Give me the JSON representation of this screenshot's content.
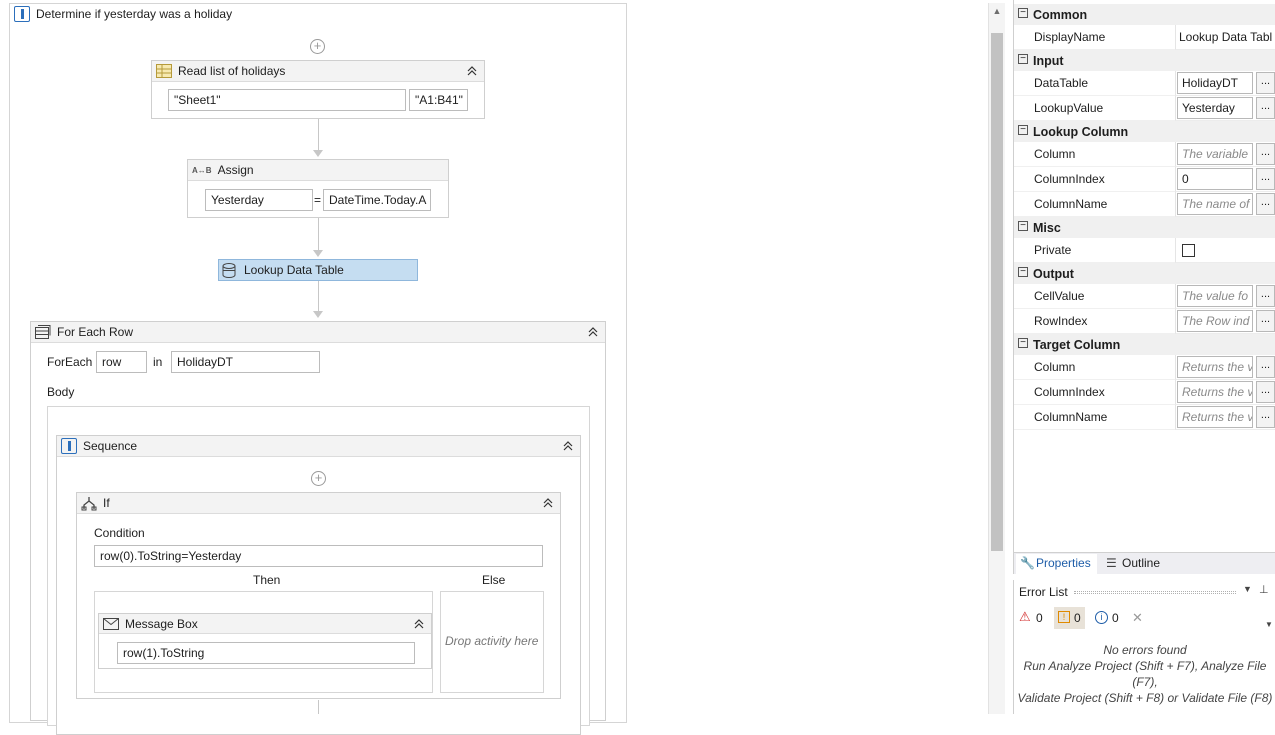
{
  "workflow": {
    "sequence_title": "Determine if yesterday was a holiday",
    "read_range": {
      "title": "Read list of holidays",
      "sheet": "\"Sheet1\"",
      "range": "\"A1:B41\""
    },
    "assign": {
      "title": "Assign",
      "to": "Yesterday",
      "eq": "=",
      "value": "DateTime.Today.A"
    },
    "lookup": {
      "title": "Lookup Data Table"
    },
    "foreach": {
      "title": "For Each Row",
      "foreach_label": "ForEach",
      "item": "row",
      "in_label": "in",
      "collection": "HolidayDT",
      "body_label": "Body",
      "sequence": {
        "title": "Sequence",
        "if": {
          "title": "If",
          "condition_label": "Condition",
          "condition": "row(0).ToString=Yesterday",
          "then_label": "Then",
          "else_label": "Else",
          "else_placeholder": "Drop activity here",
          "message_box": {
            "title": "Message Box",
            "text": "row(1).ToString"
          }
        }
      }
    }
  },
  "properties": {
    "categories": [
      {
        "name": "Common",
        "rows": [
          {
            "name": "DisplayName",
            "value": "Lookup Data Tabl",
            "plain": true
          }
        ]
      },
      {
        "name": "Input",
        "rows": [
          {
            "name": "DataTable",
            "value": "HolidayDT"
          },
          {
            "name": "LookupValue",
            "value": "Yesterday"
          }
        ]
      },
      {
        "name": "Lookup Column",
        "rows": [
          {
            "name": "Column",
            "placeholder": "The variable"
          },
          {
            "name": "ColumnIndex",
            "value": "0"
          },
          {
            "name": "ColumnName",
            "placeholder": "The name of"
          }
        ]
      },
      {
        "name": "Misc",
        "rows": [
          {
            "name": "Private",
            "checkbox": true
          }
        ]
      },
      {
        "name": "Output",
        "rows": [
          {
            "name": "CellValue",
            "placeholder": "The value fo"
          },
          {
            "name": "RowIndex",
            "placeholder": "The Row ind"
          }
        ]
      },
      {
        "name": "Target Column",
        "rows": [
          {
            "name": "Column",
            "placeholder": "Returns the v"
          },
          {
            "name": "ColumnIndex",
            "placeholder": "Returns the v"
          },
          {
            "name": "ColumnName",
            "placeholder": "Returns the v"
          }
        ]
      }
    ],
    "expander_symbol": "⊟",
    "dots": "..."
  },
  "tabs": {
    "properties": "Properties",
    "outline": "Outline"
  },
  "error_list": {
    "title": "Error List",
    "errors": "0",
    "warnings": "0",
    "messages": "0",
    "no_errors": "No errors found",
    "hint_line1": "Run Analyze Project (Shift + F7), Analyze File (F7),",
    "hint_line2": "Validate Project (Shift + F8) or Validate File (F8)"
  },
  "colors": {
    "selected_activity": "#c5ddf1",
    "accent_blue": "#2c6fbb",
    "error_red": "#d32f2f",
    "warning_orange": "#e08a00"
  }
}
